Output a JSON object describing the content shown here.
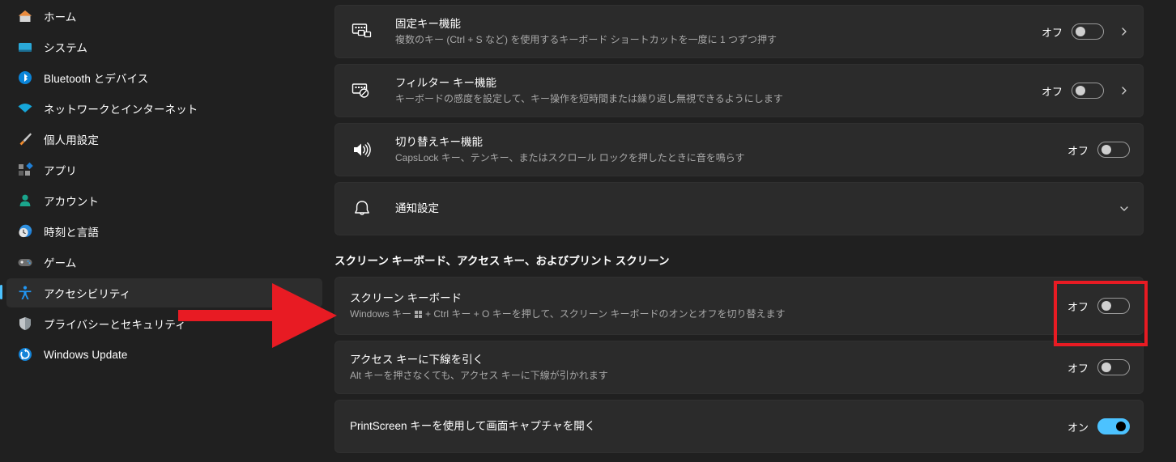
{
  "colors": {
    "accent": "#4cc2ff",
    "annotation_red": "#e81b23",
    "window_bg": "#202020",
    "card_bg": "#2b2b2b"
  },
  "sidebar": {
    "items": [
      {
        "label": "ホーム",
        "icon": "home-icon",
        "selected": false
      },
      {
        "label": "システム",
        "icon": "system-monitor-icon",
        "selected": false
      },
      {
        "label": "Bluetooth とデバイス",
        "icon": "bluetooth-icon",
        "selected": false
      },
      {
        "label": "ネットワークとインターネット",
        "icon": "wifi-icon",
        "selected": false
      },
      {
        "label": "個人用設定",
        "icon": "paintbrush-icon",
        "selected": false
      },
      {
        "label": "アプリ",
        "icon": "apps-icon",
        "selected": false
      },
      {
        "label": "アカウント",
        "icon": "account-person-icon",
        "selected": false
      },
      {
        "label": "時刻と言語",
        "icon": "clock-globe-icon",
        "selected": false
      },
      {
        "label": "ゲーム",
        "icon": "gamepad-icon",
        "selected": false
      },
      {
        "label": "アクセシビリティ",
        "icon": "accessibility-person-icon",
        "selected": true
      },
      {
        "label": "プライバシーとセキュリティ",
        "icon": "shield-icon",
        "selected": false
      },
      {
        "label": "Windows Update",
        "icon": "update-refresh-icon",
        "selected": false
      }
    ]
  },
  "main": {
    "top_rows": [
      {
        "title": "固定キー機能",
        "desc": "複数のキー (Ctrl + S など) を使用するキーボード ショートカットを一度に 1 つずつ押す",
        "icon": "sticky-keys-icon",
        "state": "オフ",
        "toggle_on": false,
        "chevron": "right"
      },
      {
        "title": "フィルター キー機能",
        "desc": "キーボードの感度を設定して、キー操作を短時間または繰り返し無視できるようにします",
        "icon": "filter-keys-icon",
        "state": "オフ",
        "toggle_on": false,
        "chevron": "right"
      },
      {
        "title": "切り替えキー機能",
        "desc": "CapsLock キー、テンキー、またはスクロール ロックを押したときに音を鳴らす",
        "icon": "toggle-keys-sound-icon",
        "state": "オフ",
        "toggle_on": false,
        "chevron": "none"
      },
      {
        "title": "通知設定",
        "desc": "",
        "icon": "bell-notification-icon",
        "state": "",
        "toggle_on": null,
        "chevron": "down"
      }
    ],
    "section_header": "スクリーン キーボード、アクセス キー、およびプリント スクリーン",
    "bottom_rows": [
      {
        "title": "スクリーン キーボード",
        "desc_before": "Windows キー",
        "desc_after": "+ Ctrl キー + O キーを押して、スクリーン キーボードのオンとオフを切り替えます",
        "icon": "none",
        "state": "オフ",
        "toggle_on": false,
        "chevron": "none",
        "highlighted": true
      },
      {
        "title": "アクセス キーに下線を引く",
        "desc": "Alt キーを押さなくても、アクセス キーに下線が引かれます",
        "icon": "none",
        "state": "オフ",
        "toggle_on": false,
        "chevron": "none",
        "highlighted": false
      },
      {
        "title": "PrintScreen キーを使用して画面キャプチャを開く",
        "desc": "",
        "icon": "none",
        "state": "オン",
        "toggle_on": true,
        "chevron": "none",
        "highlighted": false
      }
    ]
  },
  "annotations": {
    "arrow": "red-right-arrow-pointing-to-screen-keyboard-row",
    "box": "red-rectangle-around-screen-keyboard-toggle"
  }
}
